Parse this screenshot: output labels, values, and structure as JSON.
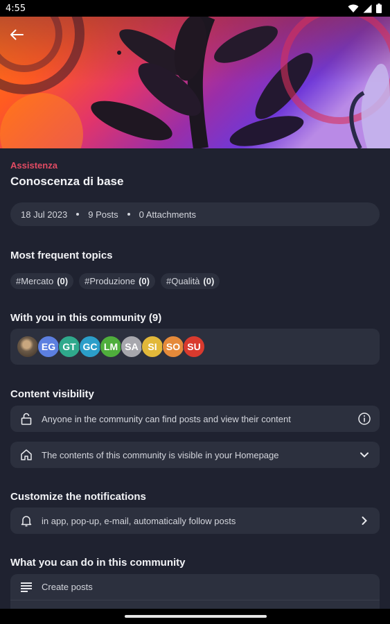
{
  "status": {
    "time": "4:55"
  },
  "community": {
    "category": "Assistenza",
    "title": "Conoscenza di base",
    "date": "18 Jul 2023",
    "posts": "9 Posts",
    "attachments": "0 Attachments"
  },
  "topics": {
    "title": "Most frequent topics",
    "items": [
      {
        "name": "#Mercato",
        "count": "(0)"
      },
      {
        "name": "#Produzione",
        "count": "(0)"
      },
      {
        "name": "#Qualità",
        "count": "(0)"
      }
    ]
  },
  "members": {
    "title": "With you in this community (9)",
    "avatars": [
      {
        "initials": "",
        "color": "#6b5a48"
      },
      {
        "initials": "EG",
        "color": "#5c7fe0"
      },
      {
        "initials": "GT",
        "color": "#2fa98c"
      },
      {
        "initials": "GC",
        "color": "#2b9ec9"
      },
      {
        "initials": "LM",
        "color": "#4fae3c"
      },
      {
        "initials": "SA",
        "color": "#a7a7ad"
      },
      {
        "initials": "SI",
        "color": "#e2b83a"
      },
      {
        "initials": "SO",
        "color": "#e58a3a"
      },
      {
        "initials": "SU",
        "color": "#d93a2e"
      }
    ]
  },
  "visibility": {
    "title": "Content visibility",
    "find_text": "Anyone in the community can find posts and view their content",
    "homepage_text": "The contents of this community is visible in your Homepage"
  },
  "notifications": {
    "title": "Customize the notifications",
    "text": "in app, pop-up, e-mail, automatically follow posts"
  },
  "actions": {
    "title": "What you can do in this community",
    "items": [
      {
        "label": "Create posts"
      }
    ]
  },
  "colors": {
    "accent": "#e24b63",
    "background": "#1f2230",
    "card": "#2c303e"
  }
}
